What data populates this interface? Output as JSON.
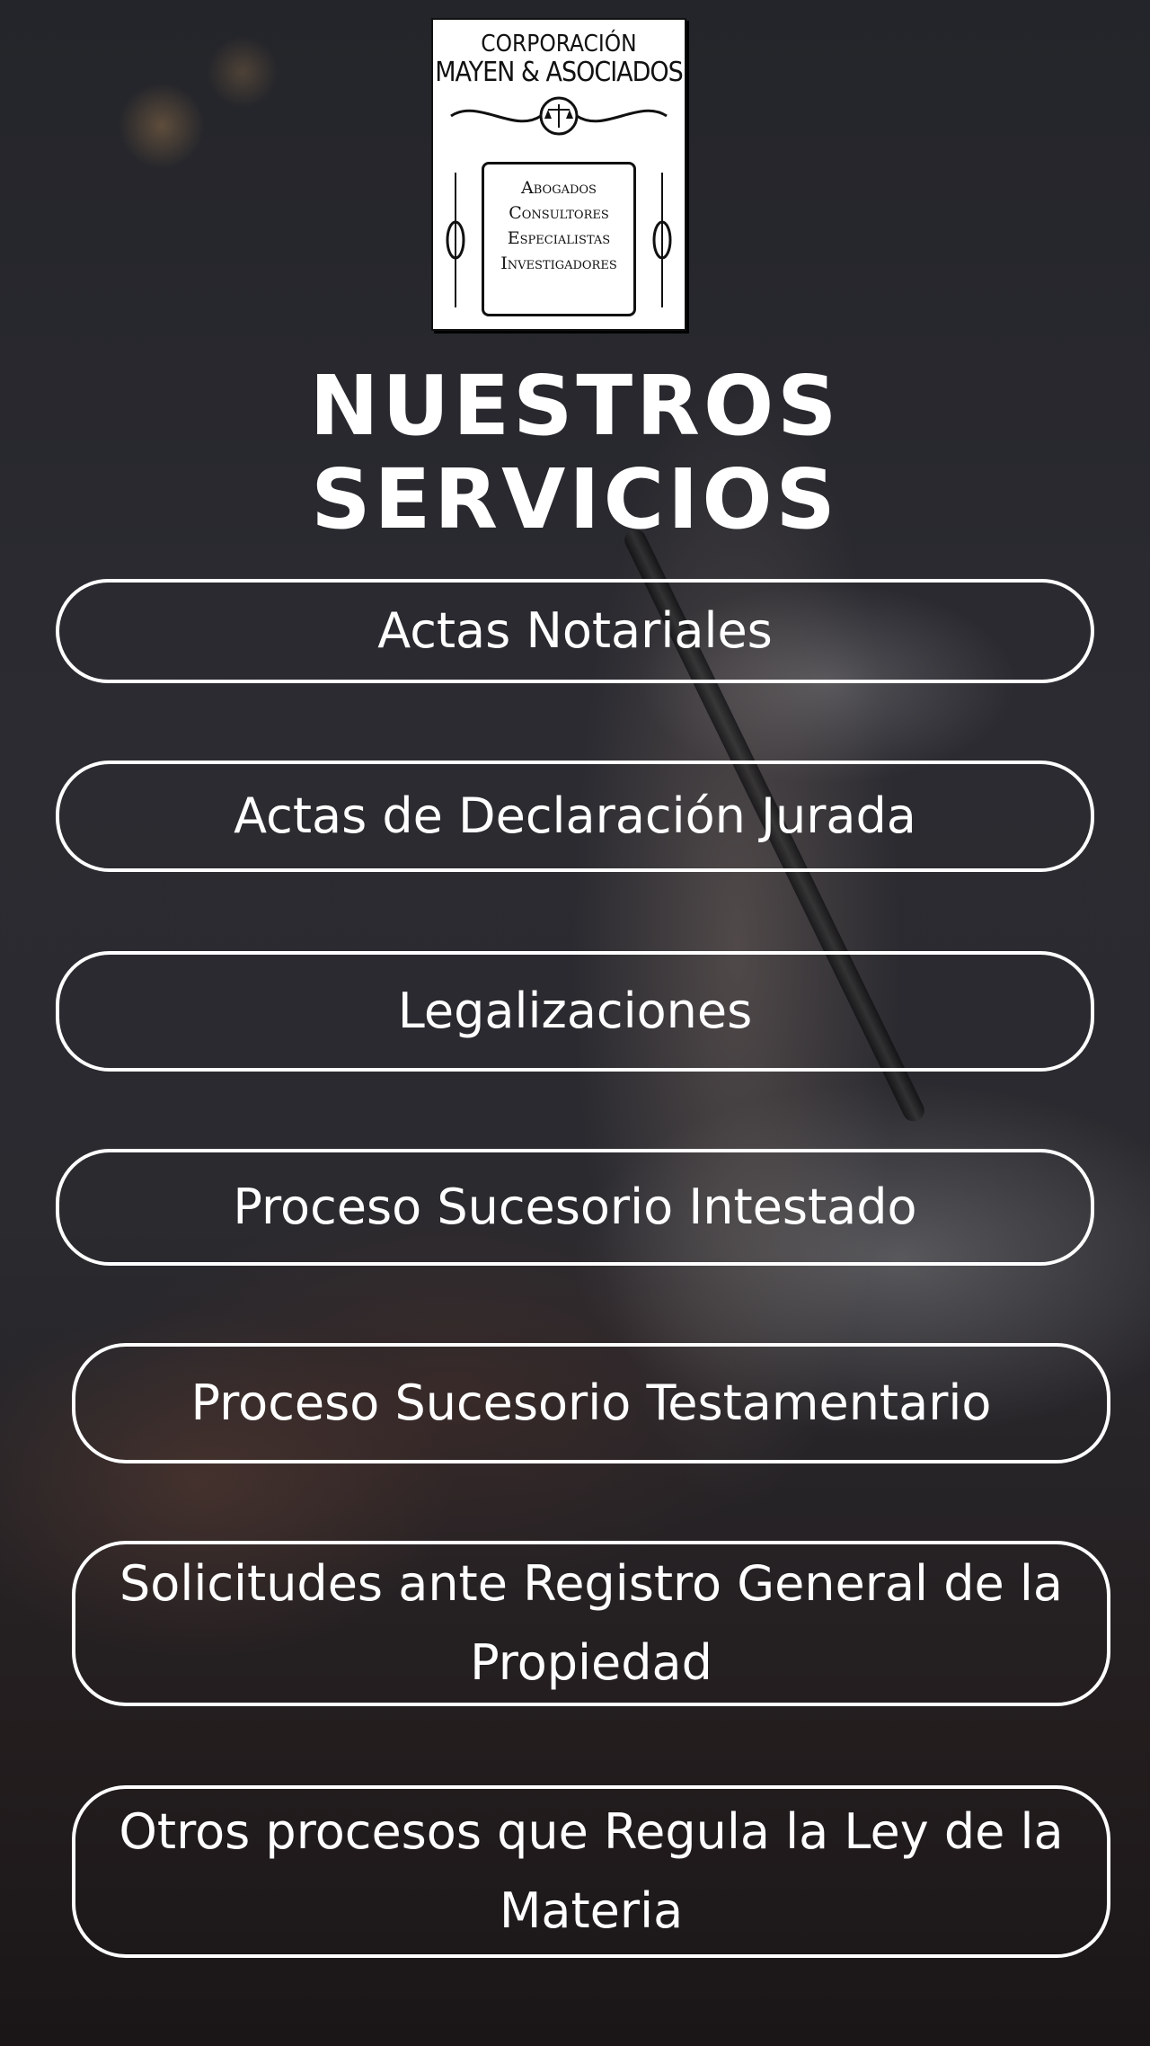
{
  "logo": {
    "line1": "CORPORACIÓN",
    "line2": "MAYEN & ASOCIADOS",
    "roles": [
      "Abogados",
      "Consultores",
      "Especialistas",
      "Investigadores"
    ]
  },
  "title": {
    "line1": "NUESTROS",
    "line2": "SERVICIOS"
  },
  "services": [
    "Actas Notariales",
    "Actas de Declaración Jurada",
    "Legalizaciones",
    "Proceso Sucesorio Intestado",
    "Proceso Sucesorio Testamentario",
    "Solicitudes ante Registro General de la Propiedad",
    "Otros procesos que Regula la Ley de la Materia"
  ]
}
